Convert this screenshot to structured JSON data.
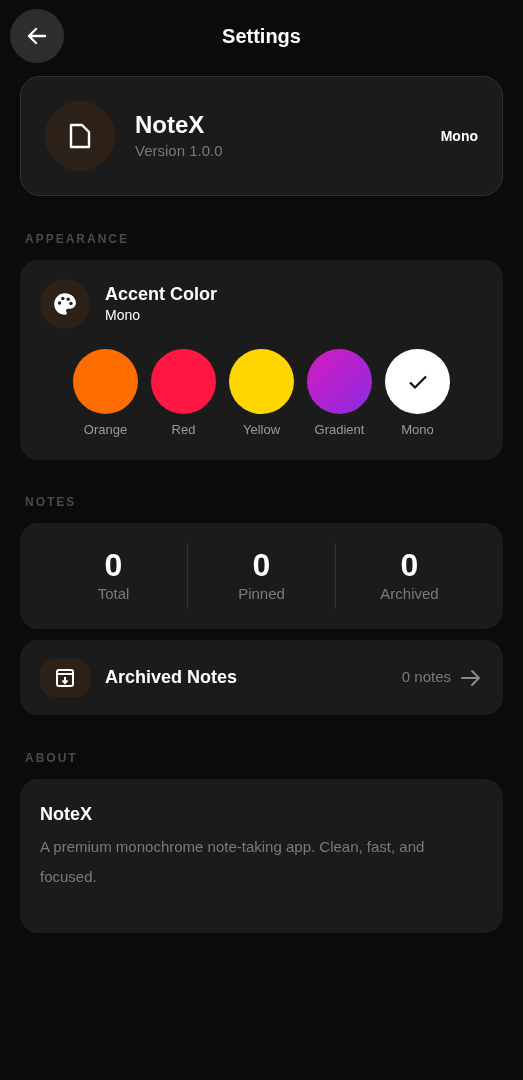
{
  "header": {
    "title": "Settings"
  },
  "app_card": {
    "name": "NoteX",
    "version": "Version 1.0.0",
    "theme": "Mono"
  },
  "appearance": {
    "label": "APPEARANCE",
    "title": "Accent Color",
    "value": "Mono",
    "swatches": [
      {
        "label": "Orange",
        "kind": "solid",
        "color": "#ff6d00",
        "selected": false
      },
      {
        "label": "Red",
        "kind": "solid",
        "color": "#ff1744",
        "selected": false
      },
      {
        "label": "Yellow",
        "kind": "solid",
        "color": "#ffd600",
        "selected": false
      },
      {
        "label": "Gradient",
        "kind": "gradient",
        "selected": false
      },
      {
        "label": "Mono",
        "kind": "solid",
        "color": "#ffffff",
        "selected": true
      }
    ]
  },
  "notes": {
    "label": "NOTES",
    "stats": [
      {
        "value": "0",
        "label": "Total"
      },
      {
        "value": "0",
        "label": "Pinned"
      },
      {
        "value": "0",
        "label": "Archived"
      }
    ],
    "archived_row": {
      "title": "Archived Notes",
      "count": "0 notes"
    }
  },
  "about": {
    "label": "ABOUT",
    "title": "NoteX",
    "description": "A premium monochrome note-taking app. Clean, fast, and focused."
  }
}
